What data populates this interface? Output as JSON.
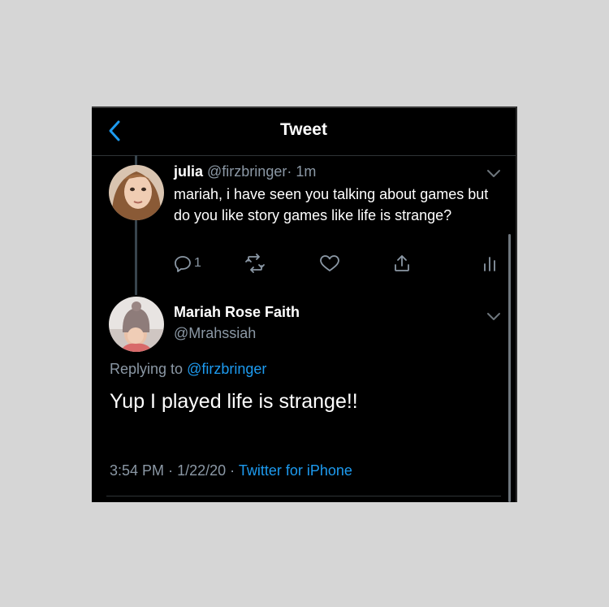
{
  "header": {
    "title": "Tweet",
    "back_icon": "chevron-left-icon",
    "accent": "#1d9bf0"
  },
  "reply_tweet": {
    "name": "julia",
    "handle": "@firzbringer",
    "separator": "·",
    "time": "1m",
    "text": "mariah, i have seen you talking about games but do you like story games like life is strange?",
    "actions": {
      "reply_count": "1",
      "icons": [
        "reply-icon",
        "retweet-icon",
        "like-icon",
        "share-icon",
        "analytics-icon"
      ]
    }
  },
  "main_tweet": {
    "name": "Mariah Rose Faith",
    "handle": "@Mrahssiah",
    "replying_prefix": "Replying to",
    "replying_to": "@firzbringer",
    "text": "Yup I played life is strange!!",
    "time": "3:54 PM",
    "date": "1/22/20",
    "dot": "·",
    "source": "Twitter for iPhone"
  },
  "colors": {
    "background": "#000000",
    "text": "#ffffff",
    "muted": "#8b98a5",
    "link": "#1d9bf0"
  }
}
